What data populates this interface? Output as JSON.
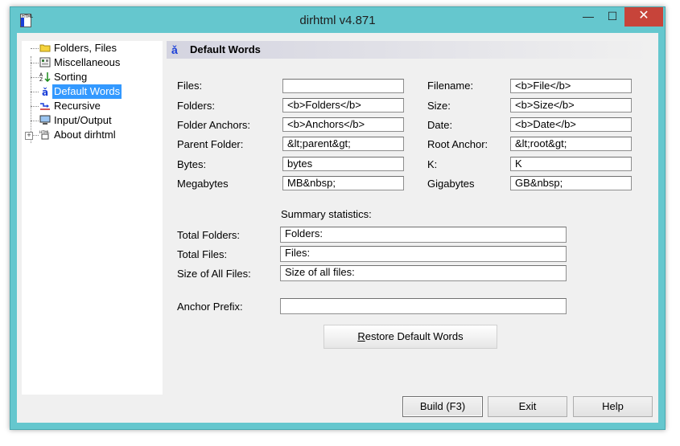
{
  "window": {
    "title": "dirhtml v4.871",
    "app_icon_text": "HTML",
    "minimize_glyph": "—",
    "maximize_glyph": "☐",
    "close_glyph": "✕"
  },
  "tree": {
    "items": [
      {
        "label": "Folders, Files",
        "icon": "folder-icon"
      },
      {
        "label": "Miscellaneous",
        "icon": "misc-icon"
      },
      {
        "label": "Sorting",
        "icon": "sort-icon"
      },
      {
        "label": "Default Words",
        "icon": "words-icon",
        "selected": true
      },
      {
        "label": "Recursive",
        "icon": "recursive-icon"
      },
      {
        "label": "Input/Output",
        "icon": "monitor-icon"
      },
      {
        "label": "About dirhtml",
        "icon": "html-icon"
      }
    ],
    "expander": "+"
  },
  "panel": {
    "icon_glyph": "ǎ",
    "title": "Default Words",
    "fields_left": [
      {
        "label": "Files:",
        "value": ""
      },
      {
        "label": "Folders:",
        "value": "<b>Folders</b>"
      },
      {
        "label": "Folder Anchors:",
        "value": "<b>Anchors</b>"
      },
      {
        "label": "Parent Folder:",
        "value": "&lt;parent&gt;"
      },
      {
        "label": "Bytes:",
        "value": "bytes"
      },
      {
        "label": "Megabytes",
        "value": "MB&nbsp;"
      }
    ],
    "fields_right": [
      {
        "label": "Filename:",
        "value": "<b>File</b>"
      },
      {
        "label": "Size:",
        "value": "<b>Size</b>"
      },
      {
        "label": "Date:",
        "value": "<b>Date</b>"
      },
      {
        "label": "Root Anchor:",
        "value": "&lt;root&gt;"
      },
      {
        "label": "K:",
        "value": "K"
      },
      {
        "label": "Gigabytes",
        "value": "GB&nbsp;"
      }
    ],
    "summary_heading": "Summary statistics:",
    "summary_fields": [
      {
        "label": "Total Folders:",
        "value": "Folders:"
      },
      {
        "label": "Total Files:",
        "value": "Files:"
      },
      {
        "label": "Size of All Files:",
        "value": "Size of all files:"
      }
    ],
    "anchor_prefix": {
      "label": "Anchor Prefix:",
      "value": ""
    },
    "restore_button": {
      "accel": "R",
      "rest": "estore Default Words"
    }
  },
  "footer": {
    "build_label": "Build (F3)",
    "exit_label": "Exit",
    "help_label": "Help"
  }
}
